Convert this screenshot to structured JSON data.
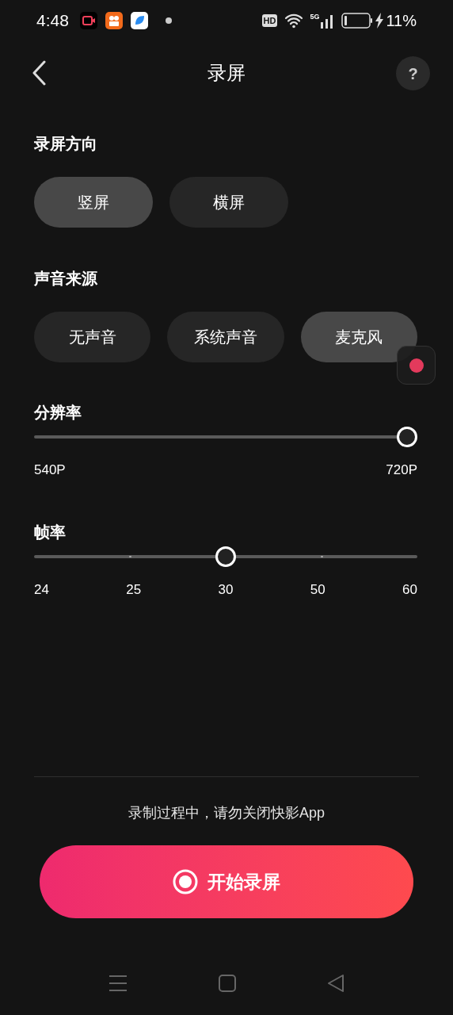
{
  "status_bar": {
    "time": "4:48",
    "hd_badge": "HD",
    "network": "5G",
    "battery": "11%"
  },
  "header": {
    "title": "录屏",
    "help": "?"
  },
  "sections": [
    {
      "kind": "options",
      "title": "录屏方向",
      "options": [
        {
          "label": "竖屏",
          "selected": true
        },
        {
          "label": "横屏",
          "selected": false
        }
      ]
    },
    {
      "kind": "options",
      "title": "声音来源",
      "options": [
        {
          "label": "无声音",
          "selected": false
        },
        {
          "label": "系统声音",
          "selected": false
        },
        {
          "label": "麦克风",
          "selected": true
        }
      ]
    },
    {
      "kind": "slider",
      "title": "分辨率",
      "level": 1,
      "labels": [
        "540P",
        "720P"
      ]
    },
    {
      "kind": "slider",
      "title": "帧率",
      "level": 0.5,
      "labels": [
        "24",
        "25",
        "30",
        "50",
        "60"
      ]
    }
  ],
  "notice": "录制过程中，请勿关闭快影App",
  "start_button": "开始录屏"
}
